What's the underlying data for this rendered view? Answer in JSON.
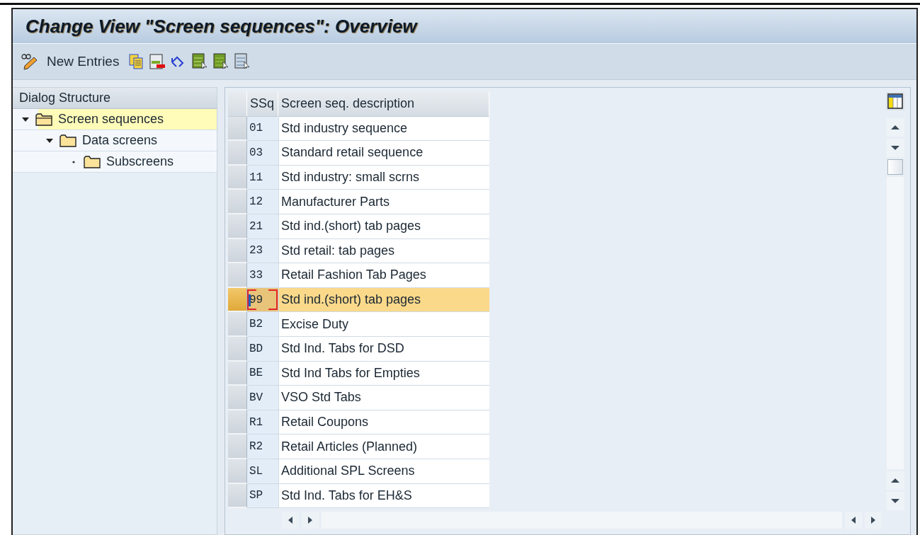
{
  "window": {
    "title": "Change View \"Screen sequences\": Overview"
  },
  "toolbar": {
    "items": [
      {
        "kind": "glasses-pencil"
      },
      {
        "kind": "text",
        "label": "New Entries"
      },
      {
        "kind": "copy"
      },
      {
        "kind": "delete"
      },
      {
        "kind": "undo"
      },
      {
        "kind": "select-all"
      },
      {
        "kind": "select-block"
      },
      {
        "kind": "deselect-all"
      }
    ]
  },
  "dialog_structure": {
    "title": "Dialog Structure",
    "tree": [
      {
        "label": "Screen sequences",
        "selected": true,
        "expanded": true,
        "children": [
          {
            "label": "Data screens",
            "selected": false,
            "expanded": true,
            "children": [
              {
                "label": "Subscreens",
                "selected": false,
                "expanded": false
              }
            ]
          }
        ]
      }
    ]
  },
  "table": {
    "columns": [
      "SSq",
      "Screen seq. description"
    ],
    "rows": [
      {
        "cells": [
          "01",
          "Std industry sequence"
        ],
        "selected": false
      },
      {
        "cells": [
          "03",
          "Standard retail sequence"
        ],
        "selected": false
      },
      {
        "cells": [
          "11",
          "Std industry: small scrns"
        ],
        "selected": false
      },
      {
        "cells": [
          "12",
          "Manufacturer Parts"
        ],
        "selected": false
      },
      {
        "cells": [
          "21",
          "Std ind.(short) tab pages"
        ],
        "selected": false
      },
      {
        "cells": [
          "23",
          "Std retail: tab pages"
        ],
        "selected": false
      },
      {
        "cells": [
          "33",
          "Retail Fashion Tab Pages"
        ],
        "selected": false
      },
      {
        "cells": [
          "99",
          "Std ind.(short) tab pages"
        ],
        "selected": true
      },
      {
        "cells": [
          "B2",
          "Excise Duty"
        ],
        "selected": false
      },
      {
        "cells": [
          "BD",
          "Std Ind. Tabs for DSD"
        ],
        "selected": false
      },
      {
        "cells": [
          "BE",
          "Std Ind Tabs for Empties"
        ],
        "selected": false
      },
      {
        "cells": [
          "BV",
          "VSO Std Tabs"
        ],
        "selected": false
      },
      {
        "cells": [
          "R1",
          "Retail Coupons"
        ],
        "selected": false
      },
      {
        "cells": [
          "R2",
          "Retail Articles (Planned)"
        ],
        "selected": false
      },
      {
        "cells": [
          "SL",
          "Additional SPL Screens"
        ],
        "selected": false
      },
      {
        "cells": [
          "SP",
          "Std Ind. Tabs for EH&S"
        ],
        "selected": false
      }
    ]
  }
}
